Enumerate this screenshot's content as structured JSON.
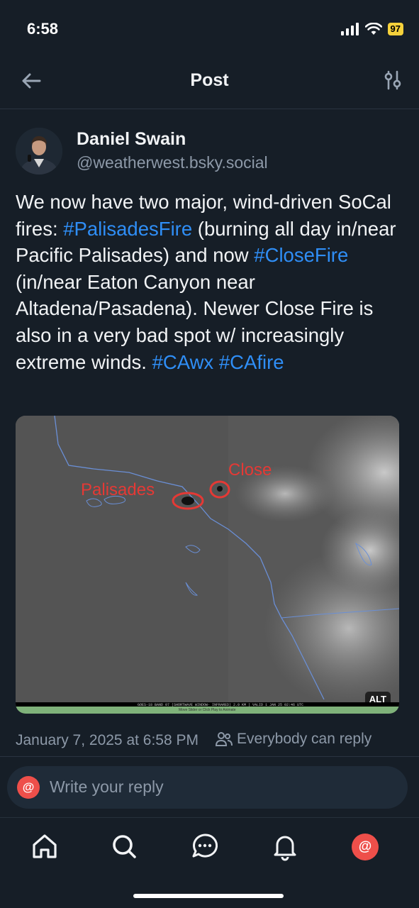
{
  "status": {
    "time": "6:58",
    "battery": "97"
  },
  "header": {
    "title": "Post"
  },
  "post": {
    "author_name": "Daniel Swain",
    "author_handle": "@weatherwest.bsky.social",
    "text_segments": [
      {
        "t": "We now have two major, wind-driven SoCal fires: ",
        "tag": false
      },
      {
        "t": "#PalisadesFire",
        "tag": true
      },
      {
        "t": " (burning all day in/near Pacific Palisades) and now ",
        "tag": false
      },
      {
        "t": "#CloseFire",
        "tag": true
      },
      {
        "t": " (in/near Eaton Canyon near Altadena/Pasadena). Newer Close Fire is also in a very bad spot w/ increasingly extreme winds. ",
        "tag": false
      },
      {
        "t": "#CAwx",
        "tag": true
      },
      {
        "t": " ",
        "tag": false
      },
      {
        "t": "#CAfire",
        "tag": true
      }
    ],
    "image": {
      "label_palisades": "Palisades",
      "label_close": "Close",
      "alt_badge": "ALT",
      "caption_line": "GOES-18 BAND 07 (SHORTWAVE WINDOW- INFRARED) 2.0 KM | VALID 1 JAN 25 02:46 UTC",
      "caption_hint": "Move Slider or Click Play to Animate"
    },
    "date": "January 7, 2025 at 6:58 PM",
    "reply_permission": "Everybody can reply"
  },
  "reply": {
    "avatar_glyph": "@",
    "placeholder": "Write your reply"
  },
  "nav": {
    "profile_glyph": "@"
  },
  "colors": {
    "background": "#161e27",
    "link": "#2f8ef6",
    "muted": "#8d99a8",
    "accent": "#ee4f4a"
  }
}
